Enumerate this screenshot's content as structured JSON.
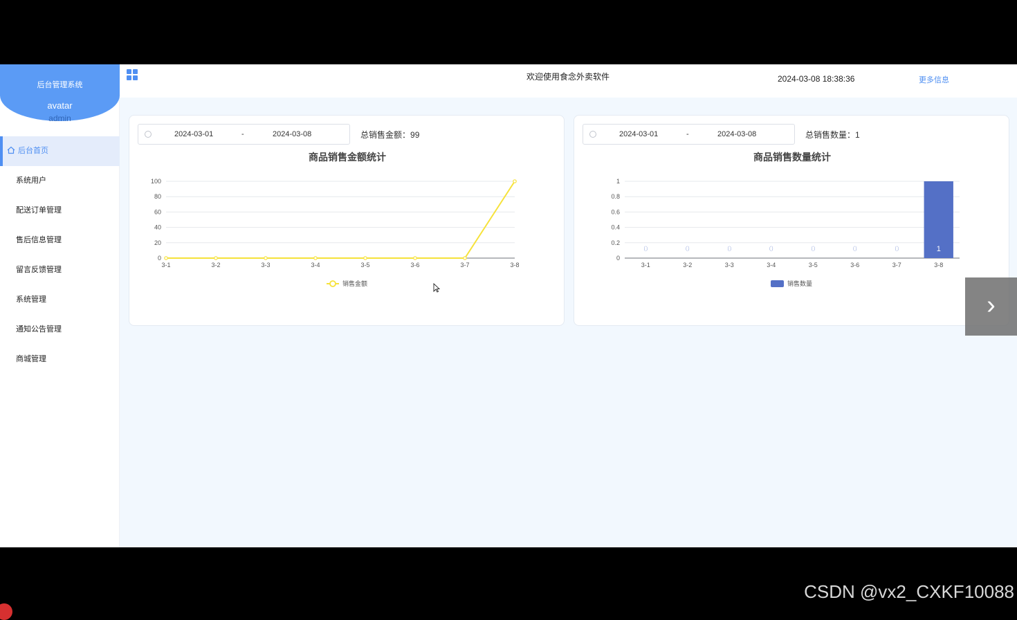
{
  "sidebar": {
    "title": "后台管理系统",
    "avatar_alt": "avatar",
    "username": "admin",
    "items": [
      {
        "label": "后台首页"
      },
      {
        "label": "系统用户"
      },
      {
        "label": "配送订单管理"
      },
      {
        "label": "售后信息管理"
      },
      {
        "label": "留言反馈管理"
      },
      {
        "label": "系统管理"
      },
      {
        "label": "通知公告管理"
      },
      {
        "label": "商城管理"
      }
    ]
  },
  "header": {
    "welcome": "欢迎使用食念外卖软件",
    "datetime": "2024-03-08 18:38:36",
    "more": "更多信息"
  },
  "left_card": {
    "start_date": "2024-03-01",
    "separator": "-",
    "end_date": "2024-03-08",
    "total_label": "总销售金额：",
    "total_value": "99"
  },
  "right_card": {
    "start_date": "2024-03-01",
    "separator": "-",
    "end_date": "2024-03-08",
    "total_label": "总销售数量：",
    "total_value": "1"
  },
  "watermark": "CSDN @vx2_CXKF10088",
  "colors": {
    "accent": "#4f8ff2",
    "line": "#f6e23a",
    "bar": "#5470c6"
  },
  "chart_data": [
    {
      "type": "line",
      "title": "商品销售金额统计",
      "categories": [
        "3-1",
        "3-2",
        "3-3",
        "3-4",
        "3-5",
        "3-6",
        "3-7",
        "3-8"
      ],
      "series": [
        {
          "name": "销售金额",
          "values": [
            0,
            0,
            0,
            0,
            0,
            0,
            0,
            100
          ]
        }
      ],
      "ylim": [
        0,
        100
      ],
      "yticks": [
        0,
        20,
        40,
        60,
        80,
        100
      ],
      "grid": true,
      "legend": "bottom"
    },
    {
      "type": "bar",
      "title": "商品销售数量统计",
      "categories": [
        "3-1",
        "3-2",
        "3-3",
        "3-4",
        "3-5",
        "3-6",
        "3-7",
        "3-8"
      ],
      "series": [
        {
          "name": "销售数量",
          "values": [
            0,
            0,
            0,
            0,
            0,
            0,
            0,
            1
          ]
        }
      ],
      "ylim": [
        0,
        1
      ],
      "yticks": [
        0,
        0.2,
        0.4,
        0.6,
        0.8,
        1
      ],
      "grid": true,
      "legend": "bottom",
      "data_labels": true
    }
  ]
}
